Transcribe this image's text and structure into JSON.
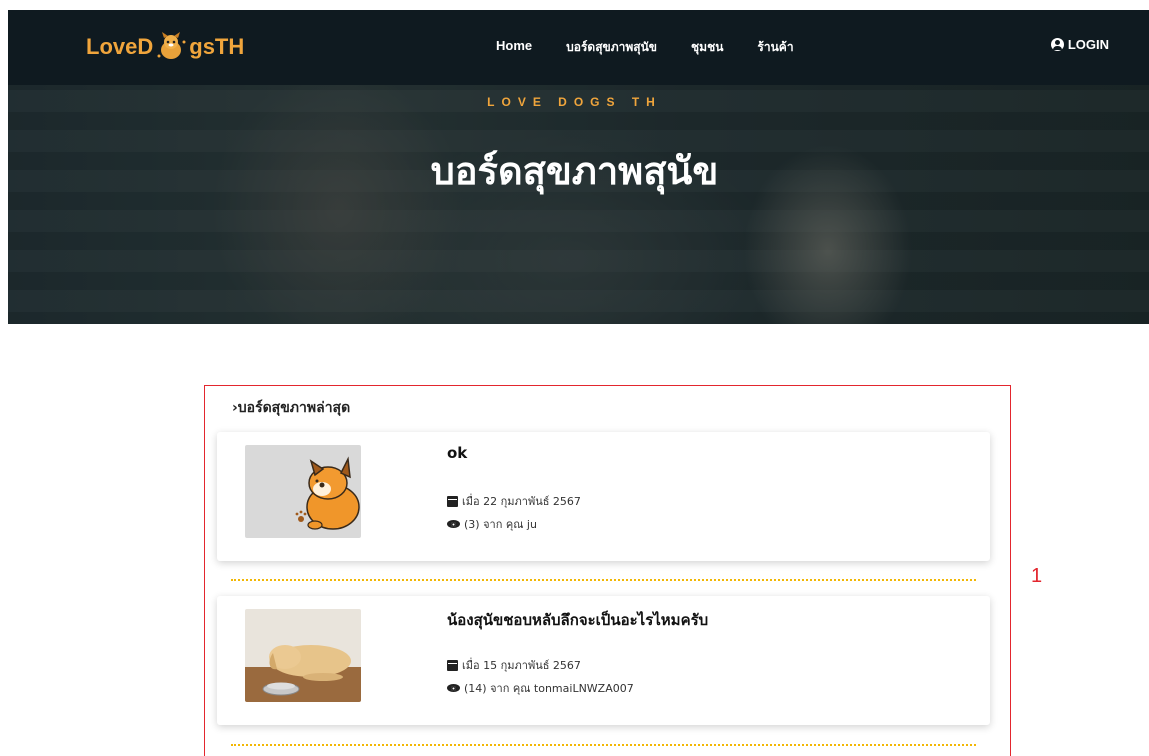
{
  "brand": {
    "logo_left": "LoveD",
    "logo_right": "gsTH"
  },
  "nav": {
    "items": [
      "Home",
      "บอร์ดสุขภาพสุนัข",
      "ชุมชน",
      "ร้านค้า"
    ],
    "login_label": "LOGIN"
  },
  "hero": {
    "subtitle": "LOVE DOGS TH",
    "title": "บอร์ดสุขภาพสุนัข"
  },
  "board": {
    "heading": "›บอร์ดสุขภาพล่าสุด",
    "posts": [
      {
        "title": "ok",
        "date": "เมื่อ 22 กุมภาพันธ์ 2567",
        "meta": "(3) จาก คุณ ju",
        "thumb": "cartoon-dog"
      },
      {
        "title": "น้องสุนัขชอบหลับลึกจะเป็นอะไรไหมครับ",
        "date": "เมื่อ 15 กุมภาพันธ์ 2567",
        "meta": "(14) จาก คุณ tonmaiLNWZA007",
        "thumb": "sleeping-dog"
      }
    ]
  },
  "annotation": "1",
  "colors": {
    "accent": "#f0a53c",
    "nav_bg": "#0f1a20",
    "divider": "#f2b705",
    "annotation": "#e3262e"
  }
}
